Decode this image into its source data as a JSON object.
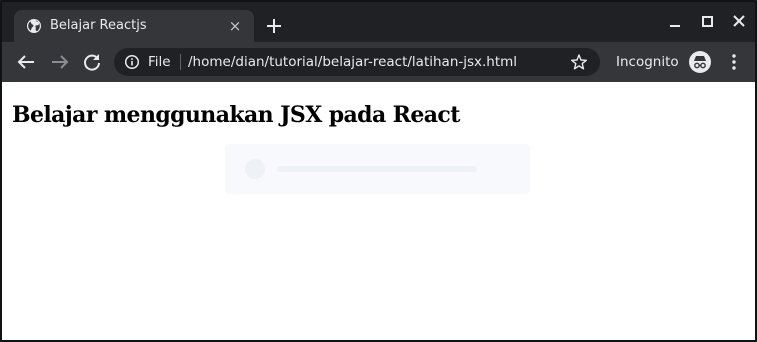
{
  "tab": {
    "title": "Belajar Reactjs",
    "favicon": "globe-icon",
    "close": "×"
  },
  "window_controls": [
    "minimize-icon",
    "maximize-icon",
    "close-icon"
  ],
  "toolbar": {
    "back": "arrow-left-icon",
    "forward": "arrow-right-icon",
    "reload": "reload-icon",
    "omnibox": {
      "info_icon": "info-icon",
      "scheme_label": "File",
      "url": "/home/dian/tutorial/belajar-react/latihan-jsx.html",
      "bookmark_icon": "star-icon"
    },
    "incognito_label": "Incognito",
    "incognito_icon": "incognito-icon",
    "menu_icon": "kebab-menu-icon"
  },
  "page": {
    "heading": "Belajar menggunakan JSX pada React"
  },
  "colors": {
    "frame": "#202124",
    "toolbar": "#35363a",
    "omnibox": "#202124",
    "text": "#e8eaed",
    "page_bg": "#ffffff"
  }
}
